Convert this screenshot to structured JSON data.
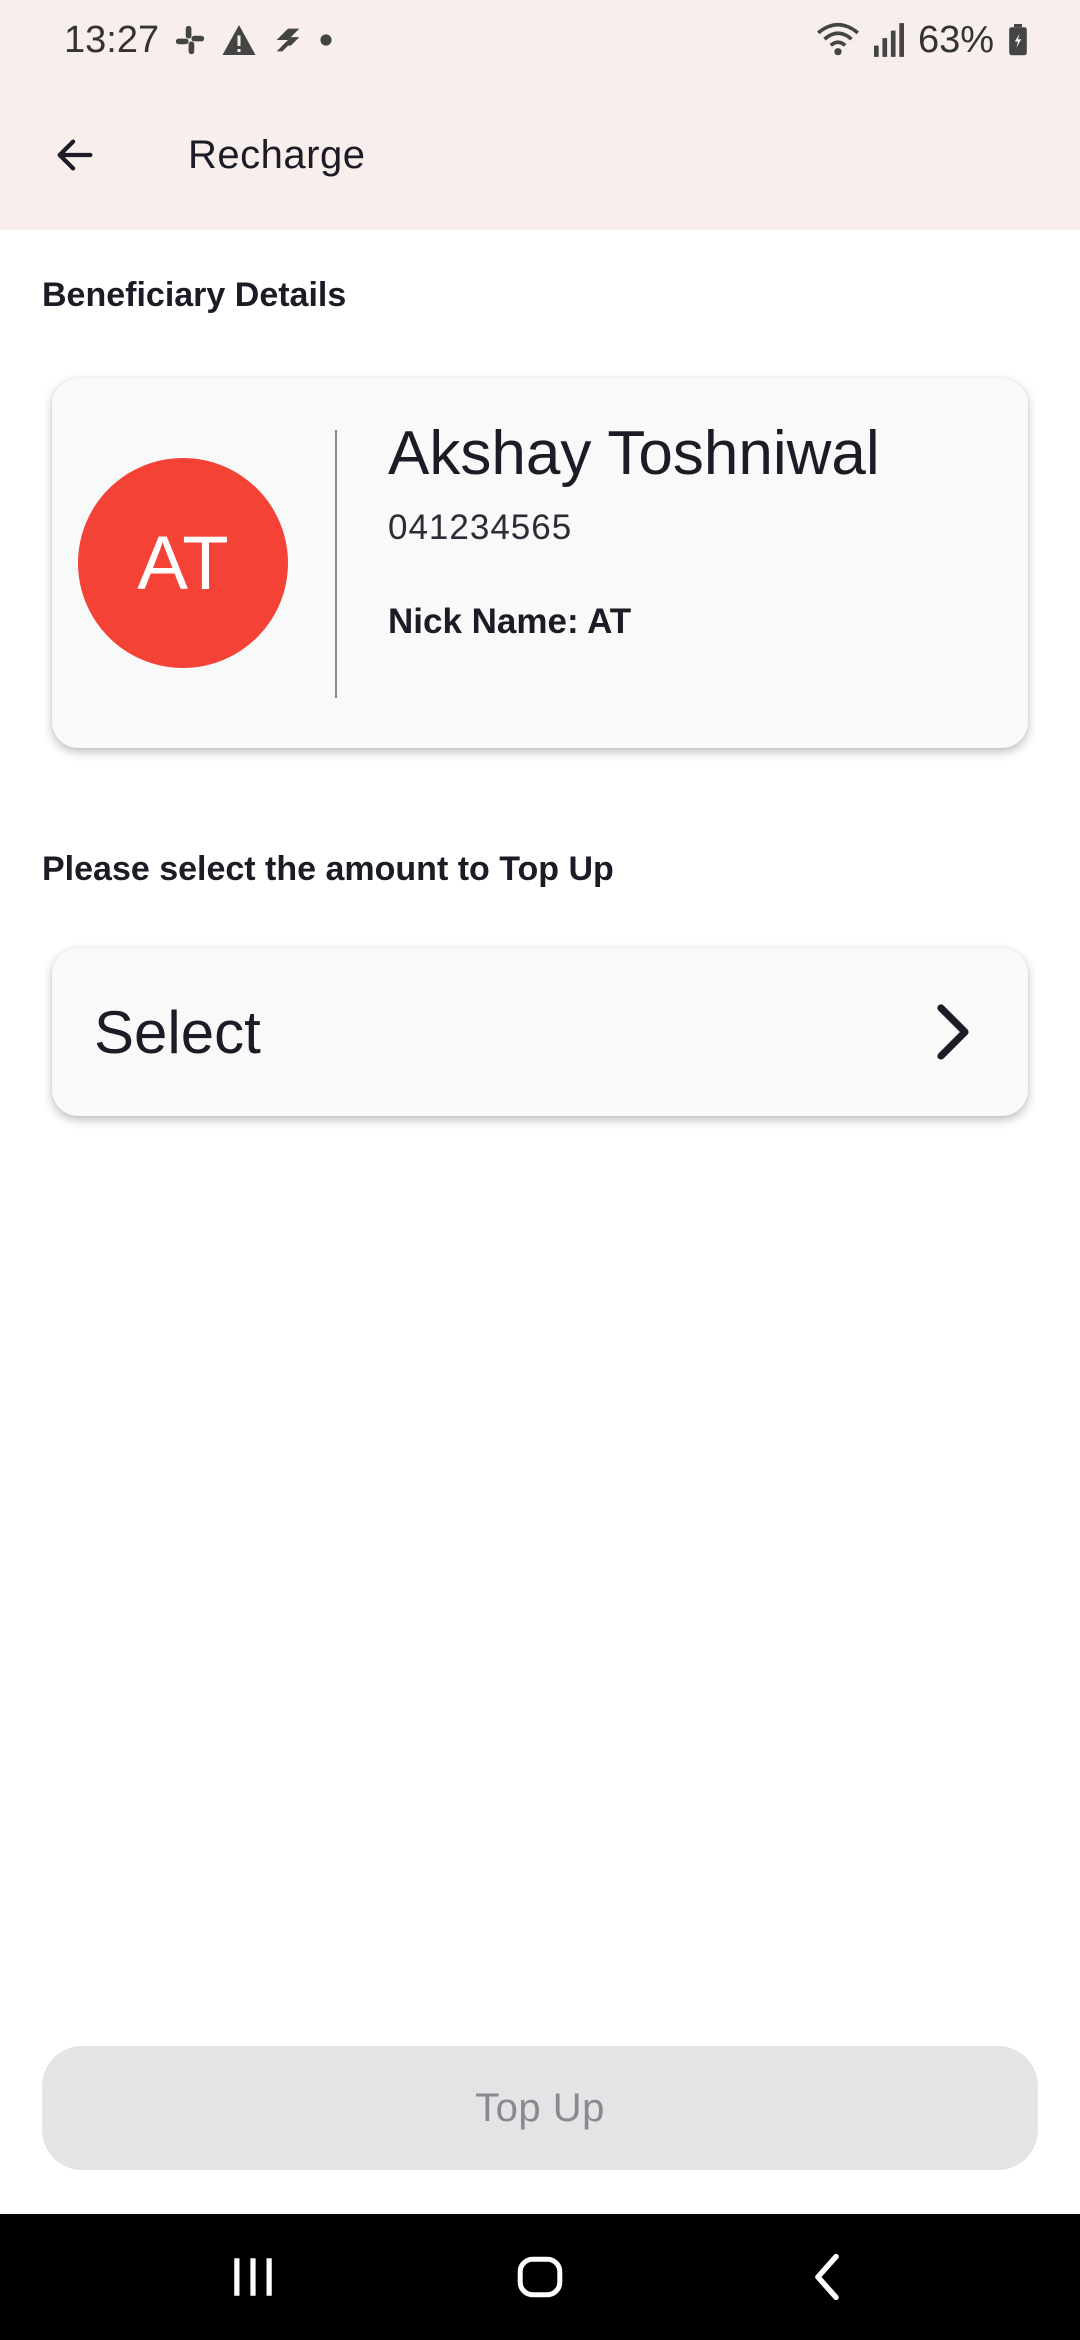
{
  "status_bar": {
    "time": "13:27",
    "battery": "63%",
    "icons_left": [
      "slack-icon",
      "warning-icon",
      "jira-icon",
      "dot-icon"
    ],
    "icons_right": [
      "wifi-icon",
      "signal-icon",
      "battery-icon"
    ]
  },
  "app_bar": {
    "title": "Recharge",
    "back_icon": "arrow-left-icon"
  },
  "beneficiary": {
    "section_label": "Beneficiary Details",
    "initials": "AT",
    "avatar_color": "#f44336",
    "name": "Akshay Toshniwal",
    "number": "041234565",
    "nickname": "Nick Name: AT"
  },
  "amount": {
    "section_label": "Please select the amount to Top Up",
    "select_label": "Select",
    "chevron_icon": "chevron-right-icon"
  },
  "actions": {
    "topup_label": "Top Up",
    "topup_enabled": false
  },
  "nav": {
    "icons": [
      "recents-icon",
      "home-icon",
      "back-icon"
    ]
  },
  "colors": {
    "header_bg": "#f8efed",
    "card_bg": "#f8f9f9",
    "button_disabled_bg": "#e4e4e6"
  }
}
